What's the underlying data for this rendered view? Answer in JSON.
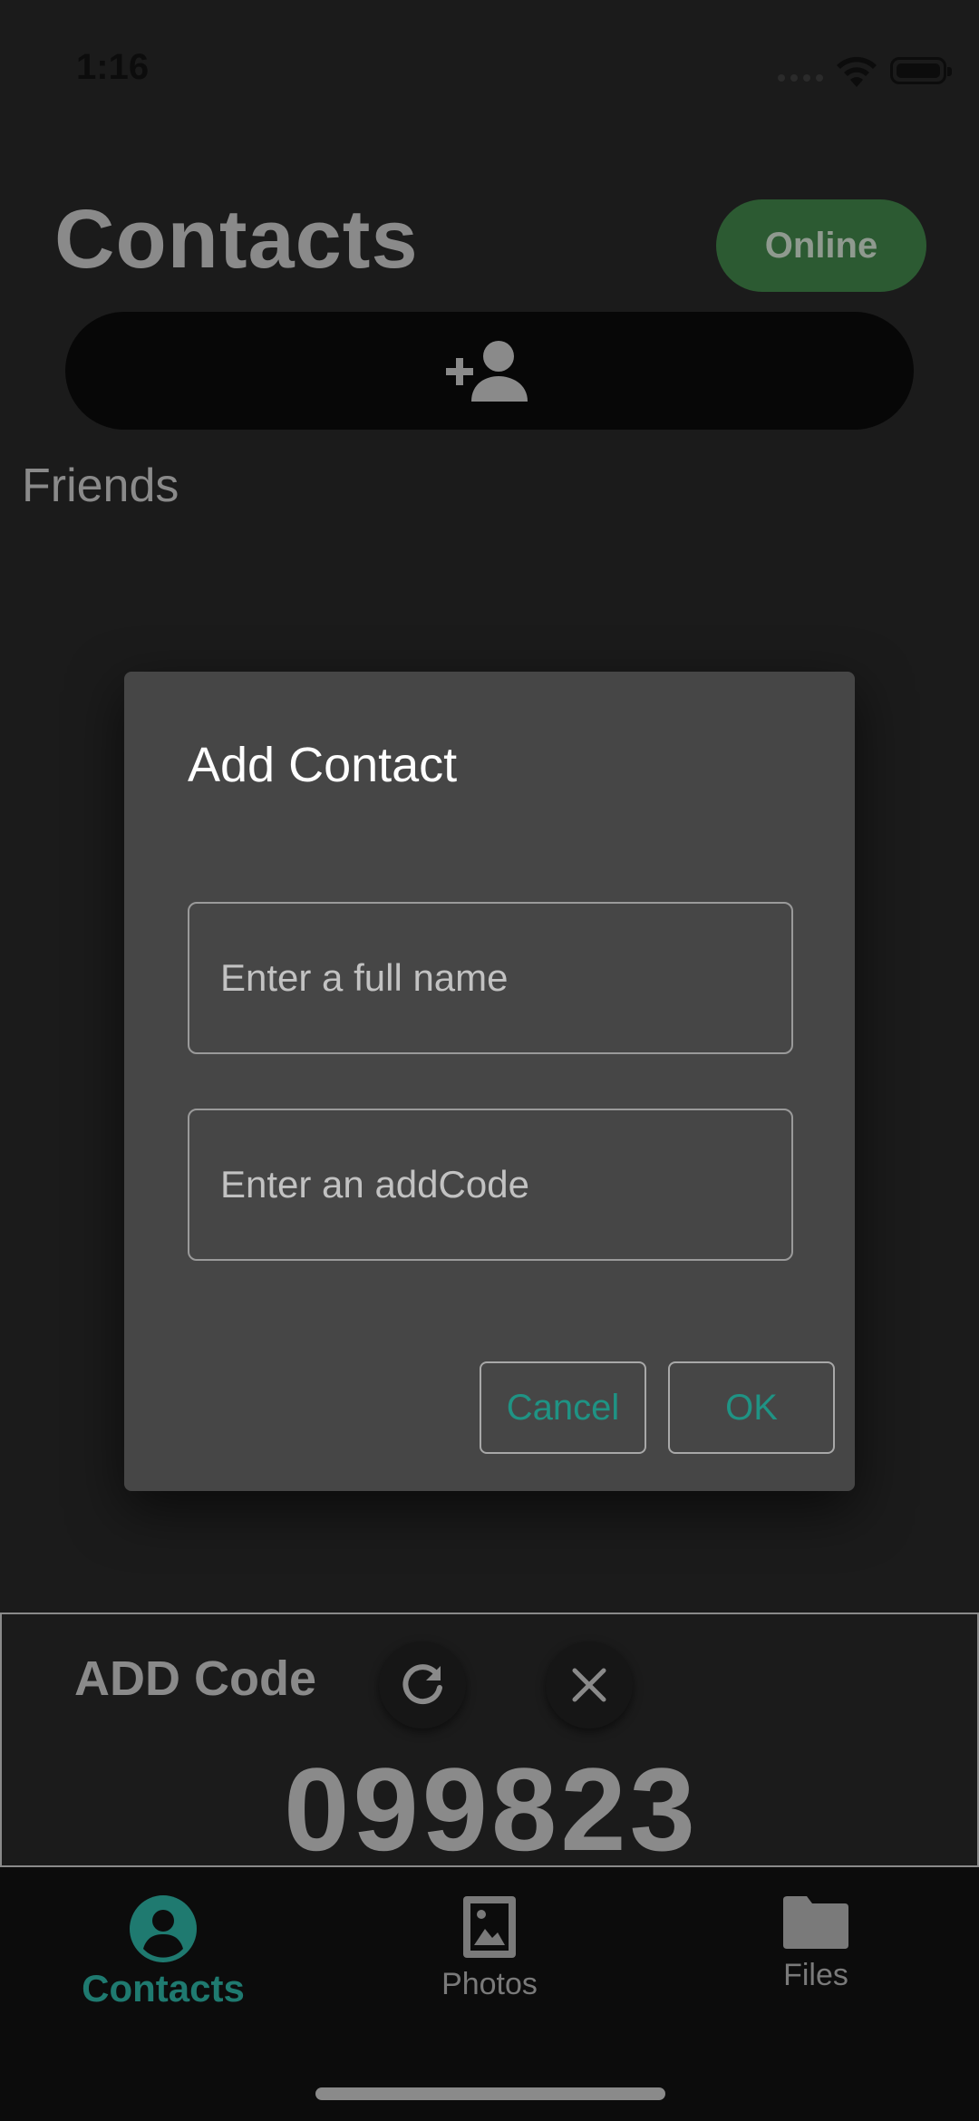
{
  "status_bar": {
    "time": "1:16"
  },
  "header": {
    "title": "Contacts",
    "status": "Online"
  },
  "add_contact_button": {
    "icon": "person-add-icon"
  },
  "section": {
    "label": "Friends"
  },
  "dialog": {
    "title": "Add Contact",
    "name_placeholder": "Enter a full name",
    "code_placeholder": "Enter an addCode",
    "cancel_label": "Cancel",
    "ok_label": "OK"
  },
  "add_code": {
    "label": "ADD Code",
    "value": "099823",
    "refresh_icon": "refresh-icon",
    "close_icon": "close-icon"
  },
  "nav": {
    "items": [
      {
        "label": "Contacts",
        "icon": "account-circle-icon",
        "active": true
      },
      {
        "label": "Photos",
        "icon": "photo-icon",
        "active": false
      },
      {
        "label": "Files",
        "icon": "folder-icon",
        "active": false
      }
    ]
  },
  "colors": {
    "background": "#1b1b1b",
    "accent": "#1f9384",
    "online_pill": "#2c5a32",
    "dialog": "#464646"
  }
}
